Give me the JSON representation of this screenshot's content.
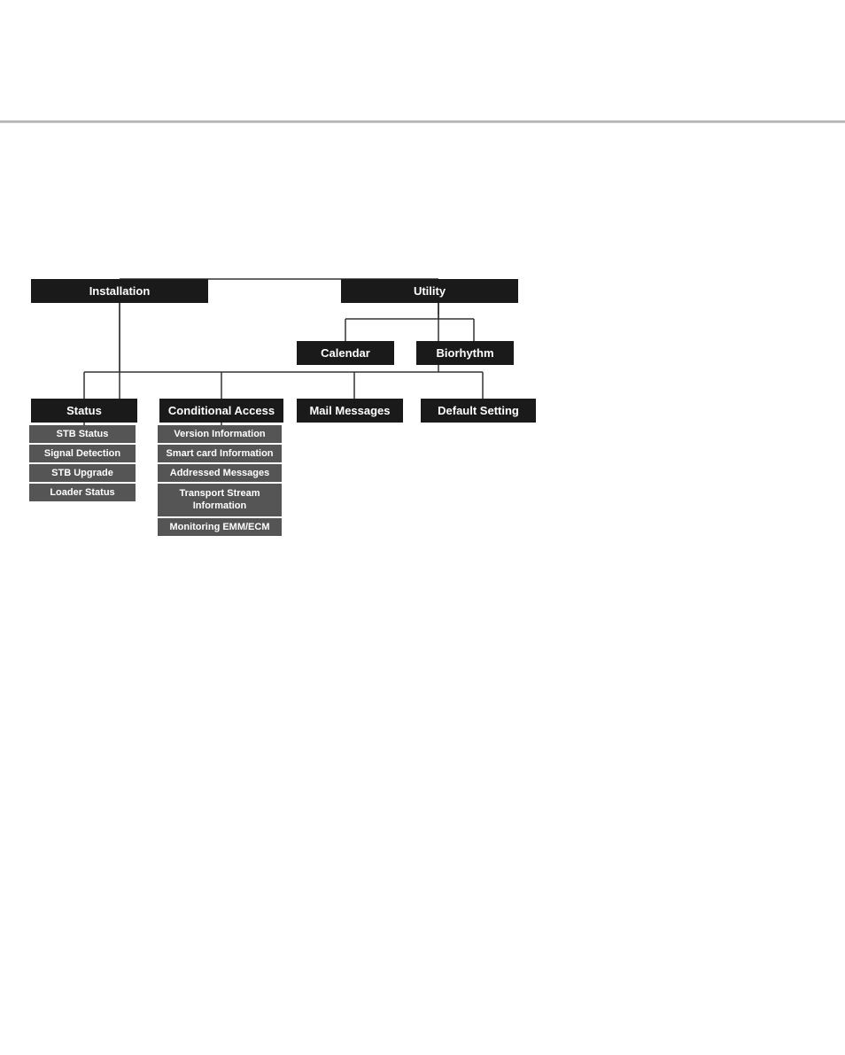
{
  "topRule": {},
  "diagram": {
    "nodes": {
      "installation": "Installation",
      "utility": "Utility",
      "calendar": "Calendar",
      "biorhythm": "Biorhythm",
      "status": "Status",
      "conditionalAccess": "Conditional Access",
      "mailMessages": "Mail Messages",
      "defaultSetting": "Default Setting"
    },
    "statusItems": [
      "STB Status",
      "Signal Detection",
      "STB Upgrade",
      "Loader Status"
    ],
    "caItems": [
      "Version Information",
      "Smart card Information",
      "Addressed Messages",
      "Transport Stream Information",
      "Monitoring EMM/ECM"
    ]
  }
}
